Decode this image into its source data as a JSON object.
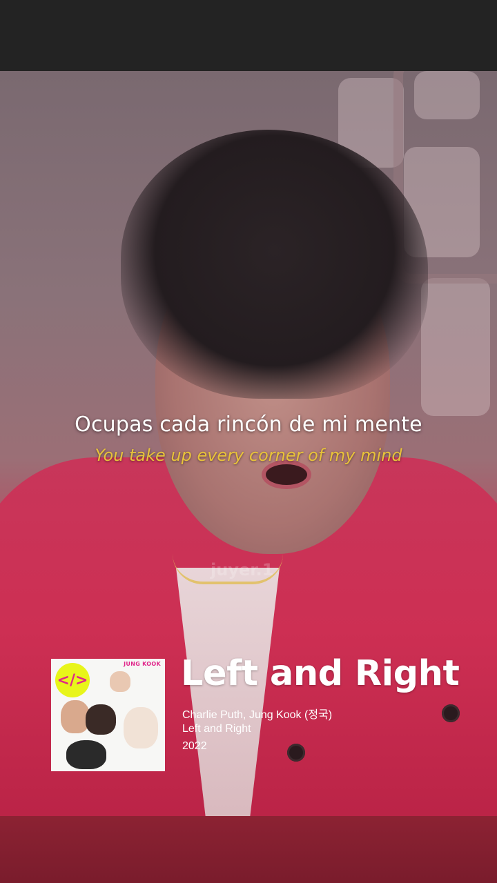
{
  "video": {
    "watermark": "juyer.1"
  },
  "lyrics": {
    "original": "Ocupas cada rincón de mi mente",
    "translation": "You take up every corner of my mind"
  },
  "track": {
    "title": "Left and Right",
    "artists": "Charlie Puth, Jung Kook (정국)",
    "album": "Left and Right",
    "year": "2022"
  },
  "cover": {
    "logo": "</>",
    "brand": "JUNG KOOK"
  },
  "colors": {
    "lyric_original": "#ffffff",
    "lyric_translation": "#e8c23a",
    "cover_logo_bg": "#e8f51a",
    "cover_accent": "#e0268a"
  }
}
